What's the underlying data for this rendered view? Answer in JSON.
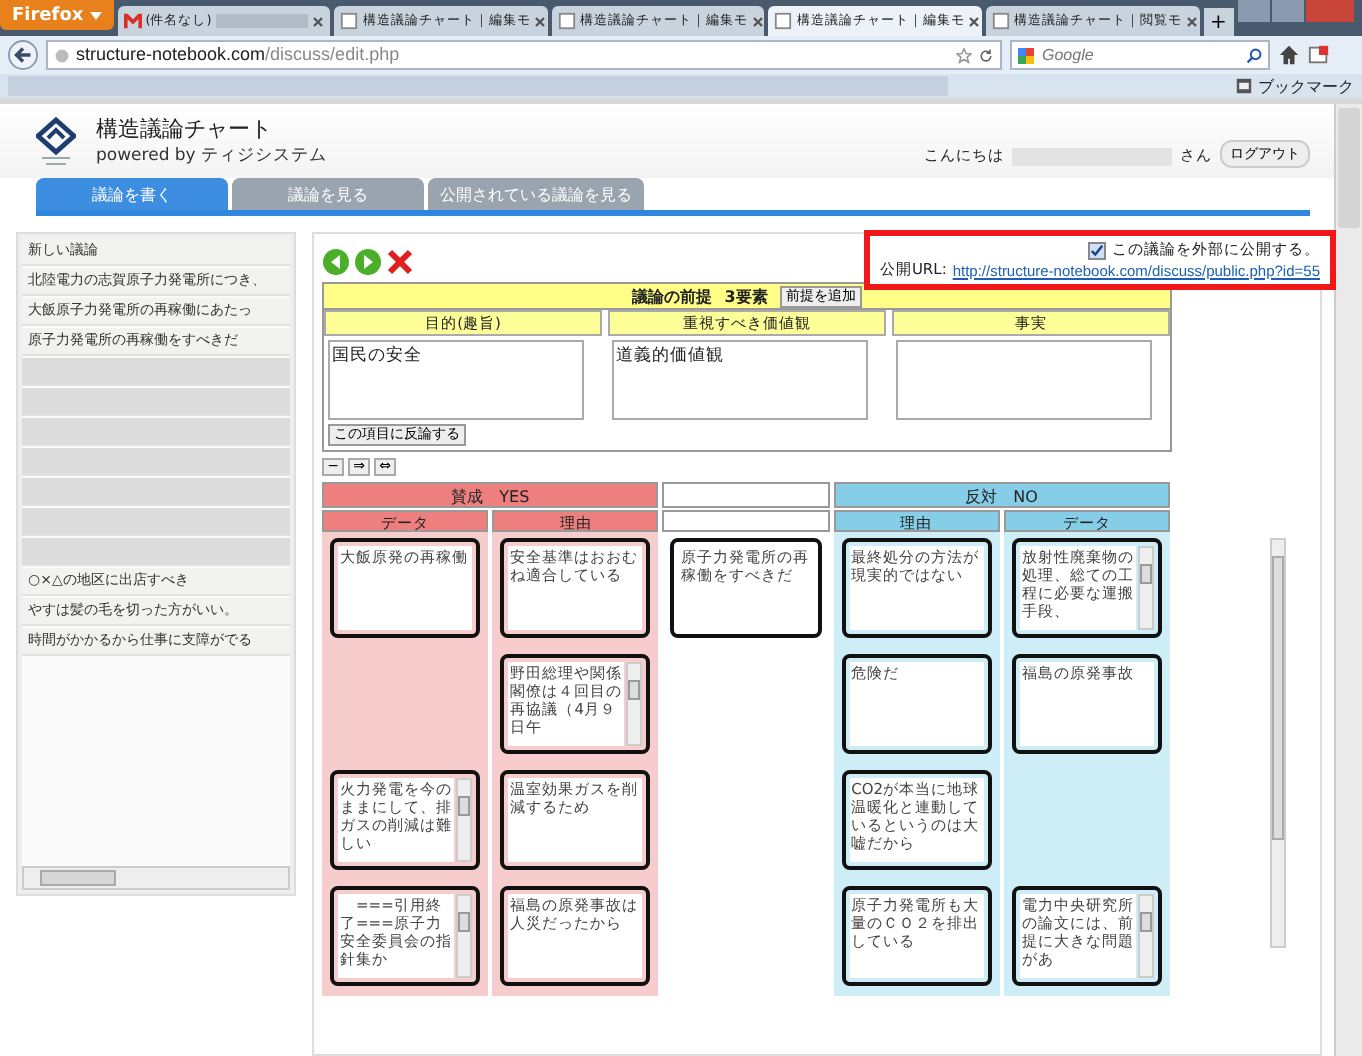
{
  "browser": {
    "menu_button": "Firefox",
    "tabs": [
      {
        "title": "(件名なし)",
        "kind": "mail",
        "selected": false
      },
      {
        "title": "構造議論チャート｜編集モ",
        "kind": "page",
        "selected": false
      },
      {
        "title": "構造議論チャート｜編集モ",
        "kind": "page",
        "selected": false
      },
      {
        "title": "構造議論チャート｜編集モ",
        "kind": "page",
        "selected": true
      },
      {
        "title": "構造議論チャート｜閲覧モ",
        "kind": "page",
        "selected": false
      }
    ],
    "new_tab": "+",
    "url_host": "structure-notebook.com",
    "url_path": "/discuss/edit.php",
    "search_placeholder": "Google",
    "bookmarks_label": "ブックマーク"
  },
  "header": {
    "title": "構造議論チャート",
    "subtitle": "powered by ティジシステム",
    "greeting": "こんにちは",
    "honorific": "さん",
    "logout": "ログアウト"
  },
  "nav_tabs": [
    {
      "label": "議論を書く",
      "selected": true
    },
    {
      "label": "議論を見る",
      "selected": false
    },
    {
      "label": "公開されている議論を見る",
      "selected": false
    }
  ],
  "sidebar": {
    "items": [
      {
        "kind": "text",
        "label": "新しい議論"
      },
      {
        "kind": "text",
        "label": "北陸電力の志賀原子力発電所につき、"
      },
      {
        "kind": "text",
        "label": "大飯原子力発電所の再稼働にあたっ"
      },
      {
        "kind": "text",
        "label": "原子力発電所の再稼働をすべきだ"
      },
      {
        "kind": "hidden"
      },
      {
        "kind": "hidden"
      },
      {
        "kind": "hidden"
      },
      {
        "kind": "hidden"
      },
      {
        "kind": "hidden"
      },
      {
        "kind": "hidden"
      },
      {
        "kind": "hidden"
      },
      {
        "kind": "text",
        "label": "○×△の地区に出店すべき"
      },
      {
        "kind": "text",
        "label": "やすは髪の毛を切った方がいい。"
      },
      {
        "kind": "text",
        "label": "時間がかかるから仕事に支障がでる"
      }
    ]
  },
  "publish": {
    "checked": true,
    "checkbox_label": "この議論を外部に公開する。",
    "url_label": "公開URL:",
    "url": "http://structure-notebook.com/discuss/public.php?id=55"
  },
  "premise": {
    "title": "議論の前提",
    "count": "3要素",
    "add_button": "前提を追加",
    "rebut_button": "この項目に反論する",
    "columns": [
      {
        "heading": "目的(趣旨)",
        "value": "国民の安全"
      },
      {
        "heading": "重視すべき価値観",
        "value": "道義的価値観"
      },
      {
        "heading": "事実"
      }
    ]
  },
  "tools": [
    "−",
    "⇒",
    "⇔"
  ],
  "board": {
    "yes_heading": "賛成　YES",
    "no_heading": "反対　NO",
    "yes_columns": [
      "データ",
      "理由"
    ],
    "no_columns": [
      "理由",
      "データ"
    ],
    "rows": [
      {
        "yes_data": {
          "text": "大飯原発の再稼働",
          "scrollbar": false
        },
        "yes_reason": {
          "text": "安全基準はおおむね適合している",
          "scrollbar": false
        },
        "claim": {
          "text": "原子力発電所の再稼働をすべきだ",
          "scrollbar": false
        },
        "no_reason": {
          "text": "最終処分の方法が現実的ではない",
          "scrollbar": false
        },
        "no_data": {
          "text": "放射性廃棄物の処理、総ての工程に必要な運搬手段、",
          "scrollbar": true
        }
      },
      {
        "yes_reason": {
          "text": "野田総理や関係閣僚は４回目の再協議（4月９日午",
          "scrollbar": true
        },
        "no_reason": {
          "text": "危険だ",
          "scrollbar": false
        },
        "no_data": {
          "text": "福島の原発事故",
          "scrollbar": false
        }
      },
      {
        "yes_data": {
          "text": "火力発電を今のままにして、排ガスの削減は難しい",
          "scrollbar": true
        },
        "yes_reason": {
          "text": "温室効果ガスを削減するため",
          "scrollbar": false
        },
        "no_reason": {
          "text": "CO2が本当に地球温暖化と連動しているというのは大嘘だから",
          "scrollbar": false
        }
      },
      {
        "yes_data": {
          "text": "　===引用終了===原子力安全委員会の指針集か",
          "scrollbar": true
        },
        "yes_reason": {
          "text": "福島の原発事故は人災だったから",
          "scrollbar": false
        },
        "no_reason": {
          "text": "原子力発電所も大量のＣＯ２を排出している",
          "scrollbar": false
        },
        "no_data": {
          "text": "電力中央研究所の論文には、前提に大きな問題があ",
          "scrollbar": true
        }
      }
    ]
  }
}
